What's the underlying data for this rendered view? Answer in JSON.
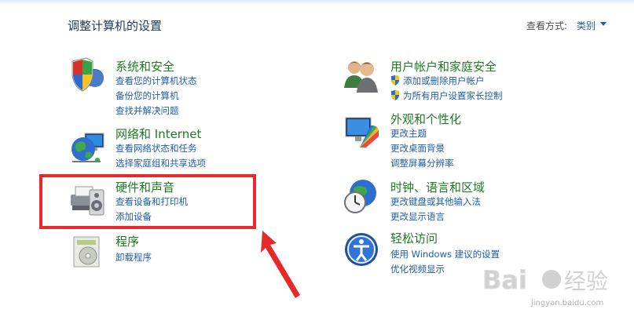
{
  "header": {
    "title": "调整计算机的设置",
    "view_by_label": "查看方式:",
    "view_mode": "类别"
  },
  "categories": [
    {
      "title": "系统和安全",
      "icon": "shield-monitor-icon",
      "links": [
        "查看您的计算机状态",
        "备份您的计算机",
        "查找并解决问题"
      ]
    },
    {
      "title": "网络和 Internet",
      "icon": "globe-network-icon",
      "links": [
        "查看网络状态和任务",
        "选择家庭组和共享选项"
      ]
    },
    {
      "title": "硬件和声音",
      "icon": "printer-speaker-icon",
      "links": [
        "查看设备和打印机",
        "添加设备"
      ]
    },
    {
      "title": "程序",
      "icon": "programs-disc-icon",
      "links": [
        "卸载程序"
      ]
    },
    {
      "title": "用户帐户和家庭安全",
      "icon": "users-icon",
      "links": [
        "添加或删除用户帐户",
        "为所有用户设置家长控制"
      ]
    },
    {
      "title": "外观和个性化",
      "icon": "monitor-palette-icon",
      "links": [
        "更改主题",
        "更改桌面背景",
        "调整屏幕分辨率"
      ]
    },
    {
      "title": "时钟、语言和区域",
      "icon": "clock-globe-icon",
      "links": [
        "更改键盘或其他输入法",
        "更改显示语言"
      ]
    },
    {
      "title": "轻松访问",
      "icon": "ease-of-access-icon",
      "links": [
        "使用 Windows 建议的设置",
        "优化视频显示"
      ]
    }
  ],
  "watermark": {
    "site": "jingyan.baidu.com"
  },
  "colors": {
    "title_green": "#1e7a23",
    "link_blue": "#1e5ea8",
    "highlight_red": "#e8282b"
  }
}
